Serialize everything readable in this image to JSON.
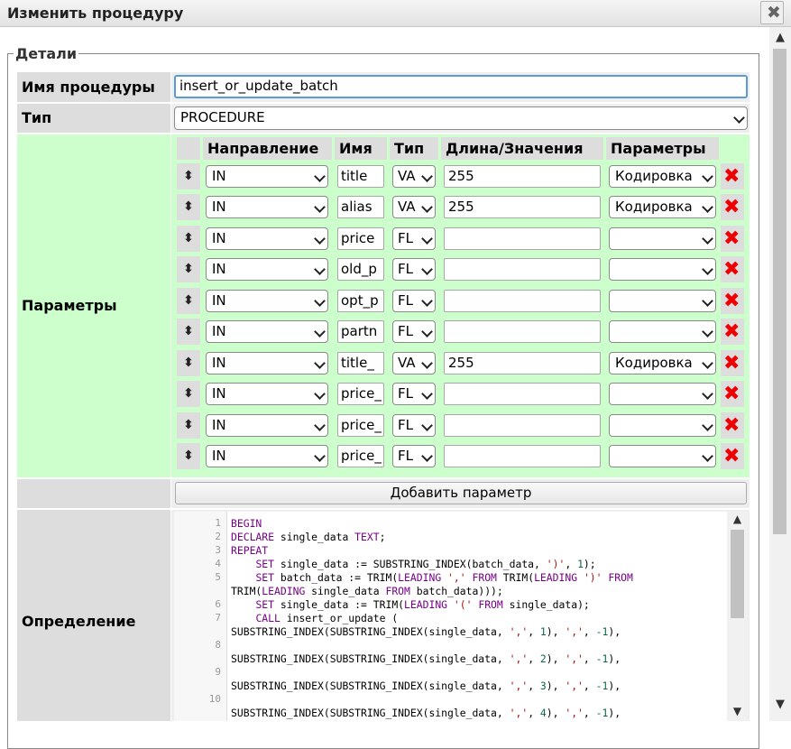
{
  "window": {
    "title": "Изменить процедуру"
  },
  "details": {
    "legend": "Детали",
    "name_label": "Имя процедуры",
    "name_value": "insert_or_update_batch",
    "type_label": "Тип",
    "type_value": "PROCEDURE",
    "params_label": "Параметры",
    "definition_label": "Определение"
  },
  "params": {
    "headers": {
      "direction": "Направление",
      "name": "Имя",
      "type": "Тип",
      "length": "Длина/Значения",
      "options": "Параметры"
    },
    "add_button": "Добавить параметр",
    "rows": [
      {
        "direction": "IN",
        "name": "title",
        "type": "VA",
        "length": "255",
        "option": "Кодировка"
      },
      {
        "direction": "IN",
        "name": "alias",
        "type": "VA",
        "length": "255",
        "option": "Кодировка"
      },
      {
        "direction": "IN",
        "name": "price",
        "type": "FL",
        "length": "",
        "option": ""
      },
      {
        "direction": "IN",
        "name": "old_p",
        "type": "FL",
        "length": "",
        "option": ""
      },
      {
        "direction": "IN",
        "name": "opt_p",
        "type": "FL",
        "length": "",
        "option": ""
      },
      {
        "direction": "IN",
        "name": "partn",
        "type": "FL",
        "length": "",
        "option": ""
      },
      {
        "direction": "IN",
        "name": "title_",
        "type": "VA",
        "length": "255",
        "option": "Кодировка"
      },
      {
        "direction": "IN",
        "name": "price_",
        "type": "FL",
        "length": "",
        "option": ""
      },
      {
        "direction": "IN",
        "name": "price_",
        "type": "FL",
        "length": "",
        "option": ""
      },
      {
        "direction": "IN",
        "name": "price_",
        "type": "FL",
        "length": "",
        "option": ""
      }
    ]
  },
  "definition": {
    "line_numbers": [
      "1",
      "2",
      "3",
      "4",
      "5",
      "6",
      "7",
      "8",
      "9",
      "10"
    ],
    "lines": [
      [
        {
          "t": "BEGIN",
          "c": "kw"
        }
      ],
      [
        {
          "t": "DECLARE",
          "c": "kw"
        },
        {
          "t": " single_data "
        },
        {
          "t": "TEXT",
          "c": "kw"
        },
        {
          "t": ";"
        }
      ],
      [
        {
          "t": "REPEAT",
          "c": "kw"
        }
      ],
      [
        {
          "t": "    "
        },
        {
          "t": "SET",
          "c": "kw"
        },
        {
          "t": " single_data := SUBSTRING_INDEX(batch_data, "
        },
        {
          "t": "')'",
          "c": "st"
        },
        {
          "t": ", "
        },
        {
          "t": "1",
          "c": "nm"
        },
        {
          "t": ");"
        }
      ],
      [
        {
          "t": "    "
        },
        {
          "t": "SET",
          "c": "kw"
        },
        {
          "t": " batch_data := TRIM("
        },
        {
          "t": "LEADING",
          "c": "kw"
        },
        {
          "t": " "
        },
        {
          "t": "','",
          "c": "st"
        },
        {
          "t": " "
        },
        {
          "t": "FROM",
          "c": "kw"
        },
        {
          "t": " TRIM("
        },
        {
          "t": "LEADING",
          "c": "kw"
        },
        {
          "t": " "
        },
        {
          "t": "')'",
          "c": "st"
        },
        {
          "t": " "
        },
        {
          "t": "FROM",
          "c": "kw"
        }
      ],
      [
        {
          "t": "TRIM("
        },
        {
          "t": "LEADING",
          "c": "kw"
        },
        {
          "t": " single_data "
        },
        {
          "t": "FROM",
          "c": "kw"
        },
        {
          "t": " batch_data)));"
        }
      ],
      [
        {
          "t": "    "
        },
        {
          "t": "SET",
          "c": "kw"
        },
        {
          "t": " single_data := TRIM("
        },
        {
          "t": "LEADING",
          "c": "kw"
        },
        {
          "t": " "
        },
        {
          "t": "'('",
          "c": "st"
        },
        {
          "t": " "
        },
        {
          "t": "FROM",
          "c": "kw"
        },
        {
          "t": " single_data);"
        }
      ],
      [
        {
          "t": "    "
        },
        {
          "t": "CALL",
          "c": "kw"
        },
        {
          "t": " insert_or_update ("
        }
      ],
      [
        {
          "t": "SUBSTRING_INDEX(SUBSTRING_INDEX(single_data, "
        },
        {
          "t": "','",
          "c": "st"
        },
        {
          "t": ", "
        },
        {
          "t": "1",
          "c": "nm"
        },
        {
          "t": "), "
        },
        {
          "t": "','",
          "c": "st"
        },
        {
          "t": ", "
        },
        {
          "t": "-1",
          "c": "nm"
        },
        {
          "t": "),"
        }
      ],
      [
        {
          "t": "SUBSTRING_INDEX(SUBSTRING_INDEX(single_data, "
        },
        {
          "t": "','",
          "c": "st"
        },
        {
          "t": ", "
        },
        {
          "t": "2",
          "c": "nm"
        },
        {
          "t": "), "
        },
        {
          "t": "','",
          "c": "st"
        },
        {
          "t": ", "
        },
        {
          "t": "-1",
          "c": "nm"
        },
        {
          "t": "),"
        }
      ],
      [
        {
          "t": "SUBSTRING_INDEX(SUBSTRING_INDEX(single_data, "
        },
        {
          "t": "','",
          "c": "st"
        },
        {
          "t": ", "
        },
        {
          "t": "3",
          "c": "nm"
        },
        {
          "t": "), "
        },
        {
          "t": "','",
          "c": "st"
        },
        {
          "t": ", "
        },
        {
          "t": "-1",
          "c": "nm"
        },
        {
          "t": "),"
        }
      ],
      [
        {
          "t": "SUBSTRING_INDEX(SUBSTRING_INDEX(single_data, "
        },
        {
          "t": "','",
          "c": "st"
        },
        {
          "t": ", "
        },
        {
          "t": "4",
          "c": "nm"
        },
        {
          "t": "), "
        },
        {
          "t": "','",
          "c": "st"
        },
        {
          "t": ", "
        },
        {
          "t": "-1",
          "c": "nm"
        },
        {
          "t": "),"
        }
      ]
    ]
  }
}
